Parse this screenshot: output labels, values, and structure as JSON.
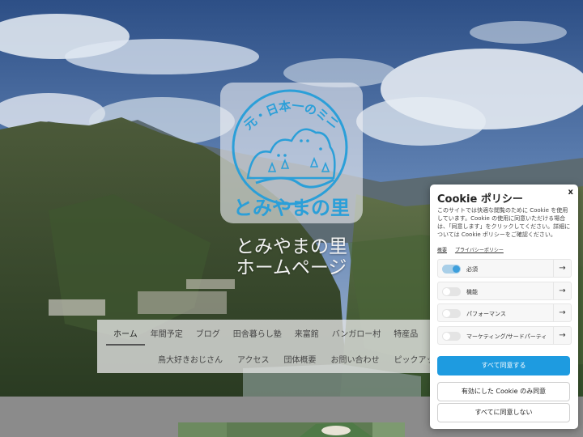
{
  "logo": {
    "alt_text": "元・日本一のミニ村 とみやまの里",
    "emblem_top": "元・日本一のミニ村",
    "emblem_bottom": "とみやまの里"
  },
  "site_title": {
    "line1": "とみやまの里",
    "line2": "ホームページ"
  },
  "nav": {
    "row1": [
      "ホーム",
      "年間予定",
      "ブログ",
      "田舎暮らし塾",
      "来富館",
      "バンガロー村",
      "特産品"
    ],
    "row2": [
      "鳥大好きおじさん",
      "アクセス",
      "団体概要",
      "お問い合わせ",
      "ピックアップ"
    ],
    "active": "ホーム"
  },
  "cookie": {
    "title": "Cookie ポリシー",
    "close": "x",
    "text": "このサイトでは快適な閲覧のために Cookie を使用しています。Cookie の使用に同意いただける場合は、「同意します」をクリックしてください。詳細については Cookie ポリシーをご確認ください。",
    "links": [
      "概要",
      "プライバシーポリシー"
    ],
    "options": [
      {
        "label": "必須",
        "enabled": true
      },
      {
        "label": "機能",
        "enabled": false
      },
      {
        "label": "パフォーマンス",
        "enabled": false
      },
      {
        "label": "マーケティング/サードパーティ",
        "enabled": false
      }
    ],
    "arrow": "→",
    "accept_all": "すべて同意する",
    "accept_selected": "有効にした Cookie のみ同意",
    "reject_all": "すべてに同意しない"
  },
  "colors": {
    "logo_blue": "#2b9fd8",
    "accept_button": "#1e9be0",
    "toggle_on": "#3d9fdc"
  }
}
